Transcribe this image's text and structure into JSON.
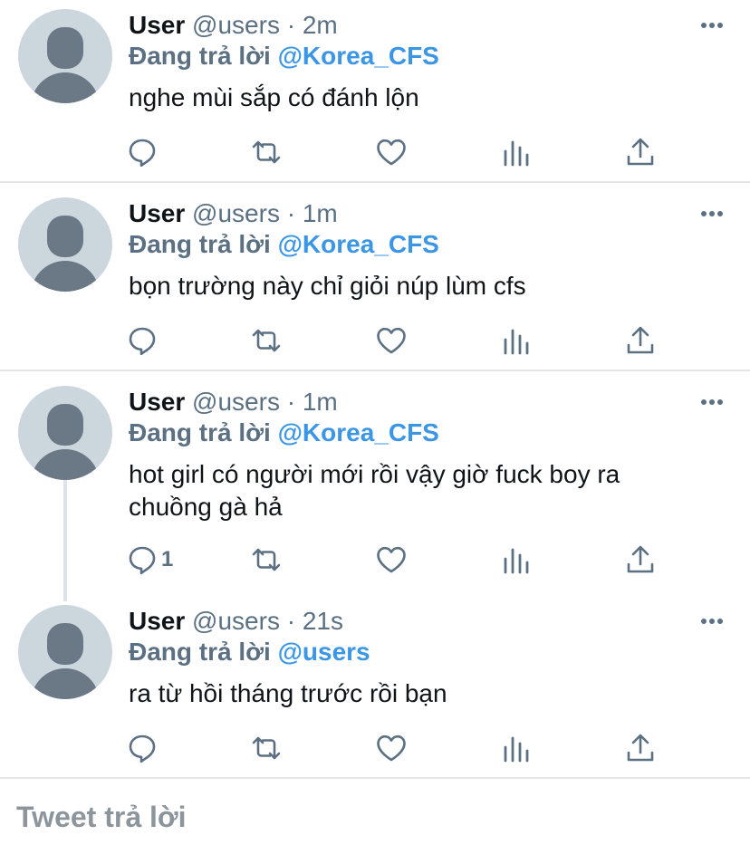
{
  "tweets": [
    {
      "name": "User",
      "handle": "@users",
      "dot": "·",
      "time": "2m",
      "reply_prefix": "Đang trả lời",
      "reply_to": "@Korea_CFS",
      "text": "nghe mùi sắp có đánh lộn",
      "reply_count": ""
    },
    {
      "name": "User",
      "handle": "@users",
      "dot": "·",
      "time": "1m",
      "reply_prefix": "Đang trả lời",
      "reply_to": "@Korea_CFS",
      "text": "bọn trường này chỉ giỏi núp lùm cfs",
      "reply_count": ""
    },
    {
      "name": "User",
      "handle": "@users",
      "dot": "·",
      "time": "1m",
      "reply_prefix": "Đang trả lời",
      "reply_to": "@Korea_CFS",
      "text": "hot girl có người mới rồi vậy giờ fuck boy ra chuồng gà hả",
      "reply_count": "1"
    },
    {
      "name": "User",
      "handle": "@users",
      "dot": "·",
      "time": "21s",
      "reply_prefix": "Đang trả lời",
      "reply_to": "@users",
      "text": "ra từ hồi tháng trước rồi bạn",
      "reply_count": ""
    }
  ],
  "compose": {
    "placeholder": "Tweet trả lời"
  },
  "icons": {
    "reply": "speech-bubble-icon",
    "retweet": "retweet-icon",
    "like": "heart-icon",
    "stats": "bar-chart-icon",
    "share": "share-upload-icon",
    "more": "more-dots-icon"
  },
  "colors": {
    "link": "#3b96e6",
    "secondary": "#5b7083",
    "avatar_bg": "#ccd6dd",
    "avatar_fg": "#6b7886",
    "divider": "#e6e6e6"
  }
}
